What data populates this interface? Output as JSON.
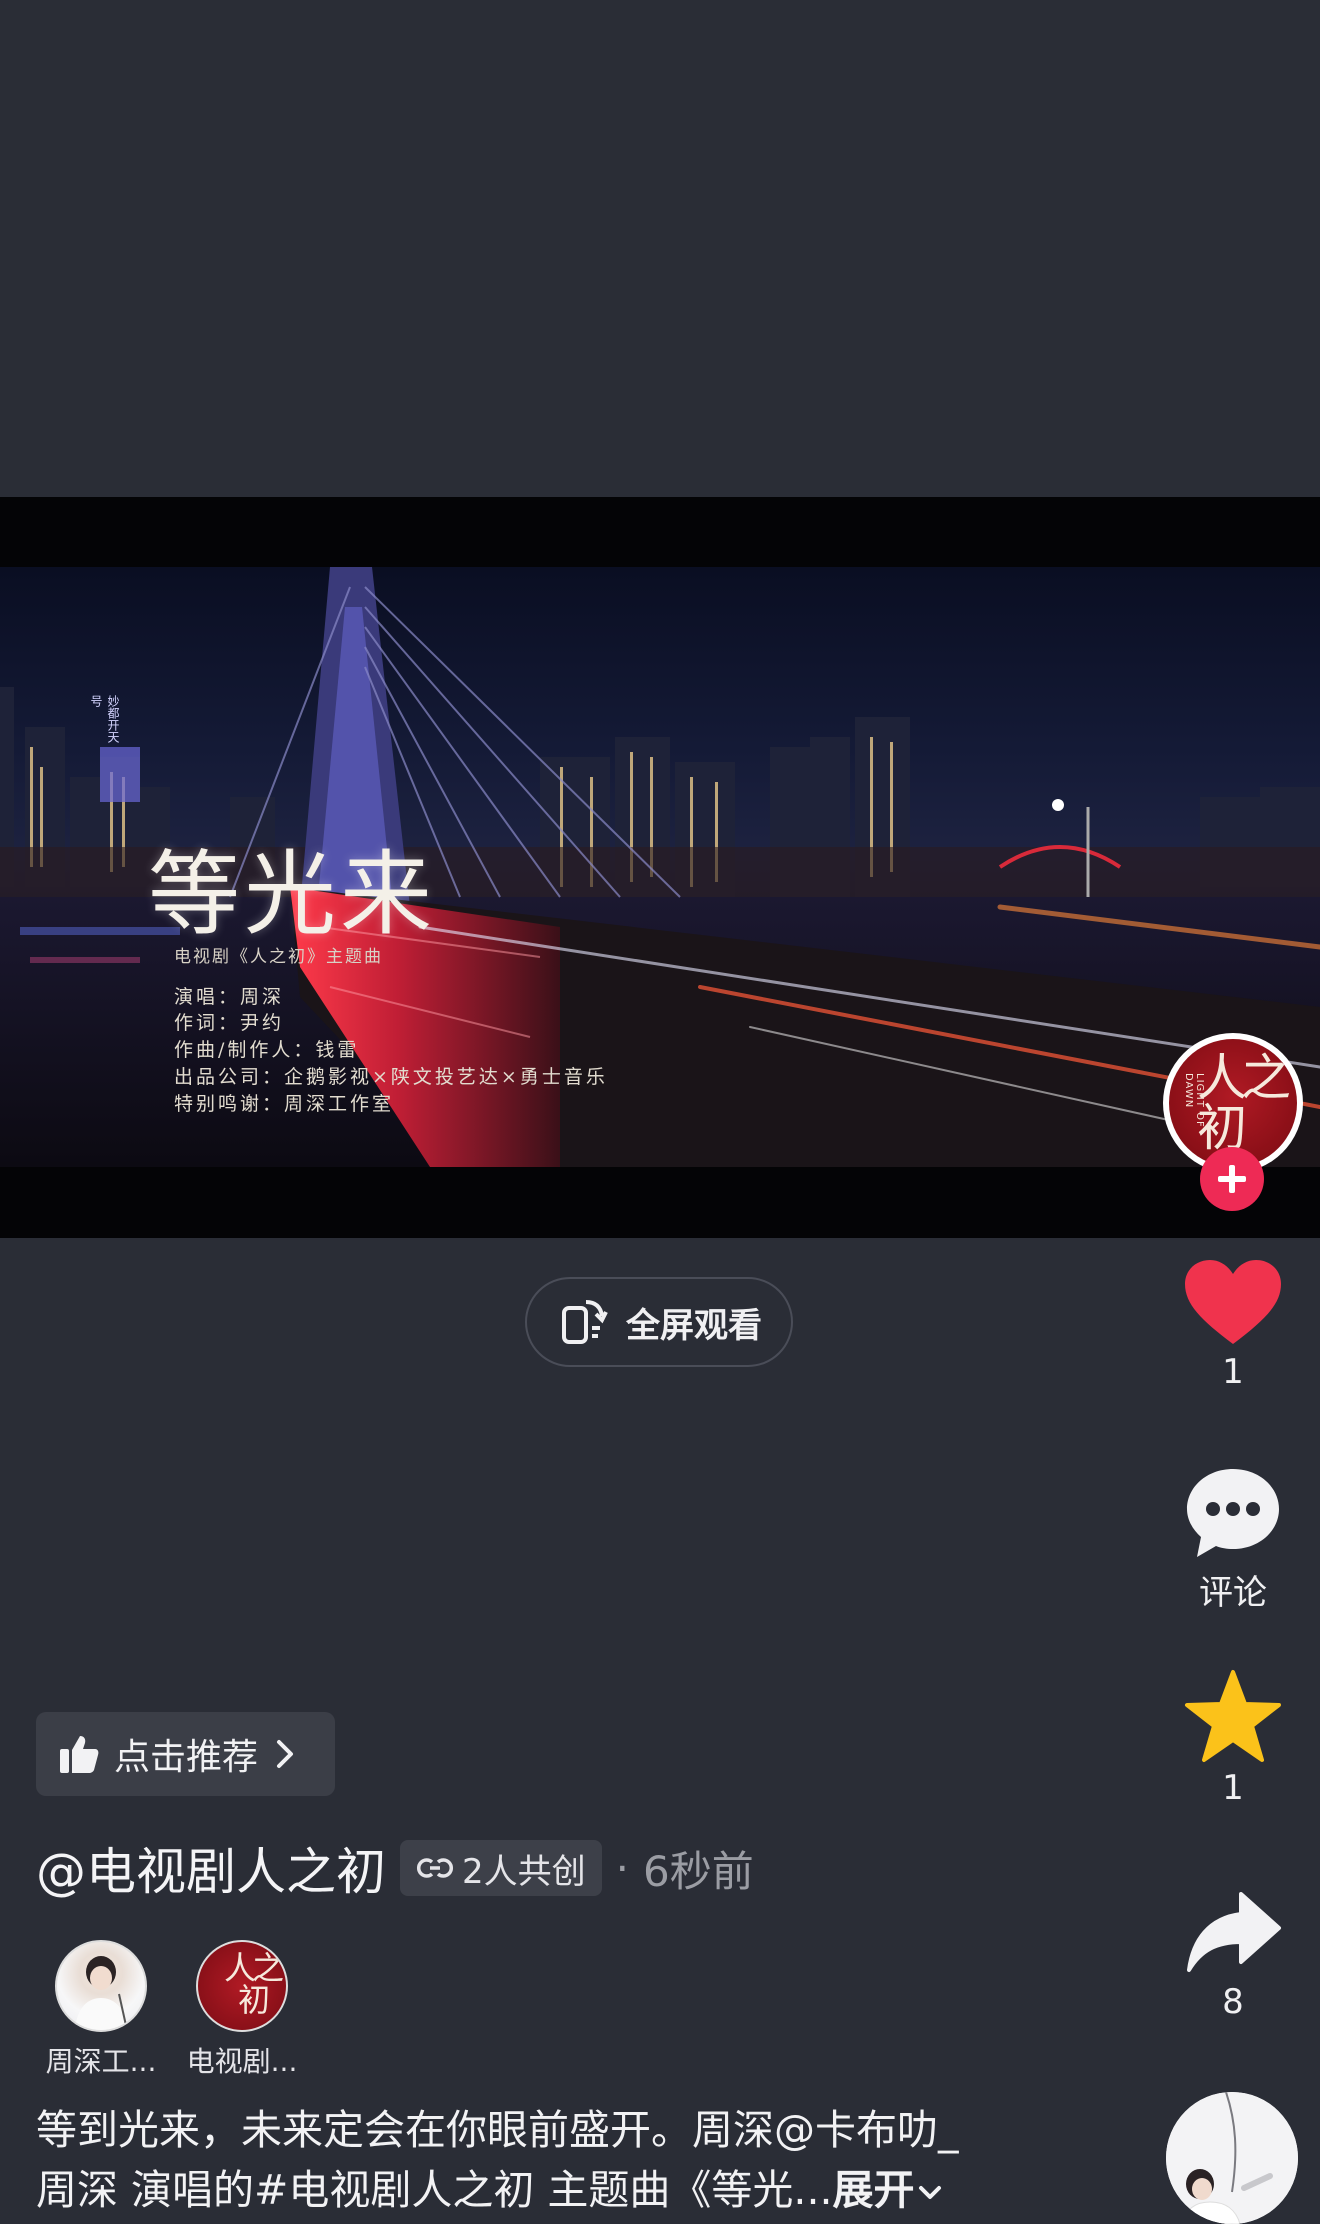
{
  "video": {
    "title_overlay": "等光来",
    "credit_top": "电视剧《人之初》主题曲",
    "credits": [
      "演唱：周深",
      "作词：尹约",
      "作曲/制作人：钱雷",
      "出品公司：企鹅影视×陕文投艺达×勇士音乐",
      "特别鸣谢：周深工作室"
    ],
    "sign_text": "妙都开天号"
  },
  "fullscreen": {
    "label": "全屏观看"
  },
  "rail": {
    "account_logo_text": "人之初",
    "account_logo_sub": "LIGHT OF DAWN",
    "like": {
      "count": "1",
      "color": "#f0334d"
    },
    "comment": {
      "label": "评论"
    },
    "favorite": {
      "count": "1",
      "color": "#fbc21a"
    },
    "share": {
      "count": "8"
    }
  },
  "recommend": {
    "label": "点击推荐"
  },
  "post": {
    "author": "@电视剧人之初",
    "cocreate": "2人共创",
    "dot": "·",
    "time": "6秒前",
    "creators": [
      {
        "name": "周深工..."
      },
      {
        "name": "电视剧..."
      }
    ],
    "creator_logo_text": "人之初",
    "desc_line1": "等到光来，未来定会在你眼前盛开。周深@卡布叻_",
    "desc_line2": "周深 演唱的#电视剧人之初 主题曲《等光...",
    "expand": "展开"
  }
}
